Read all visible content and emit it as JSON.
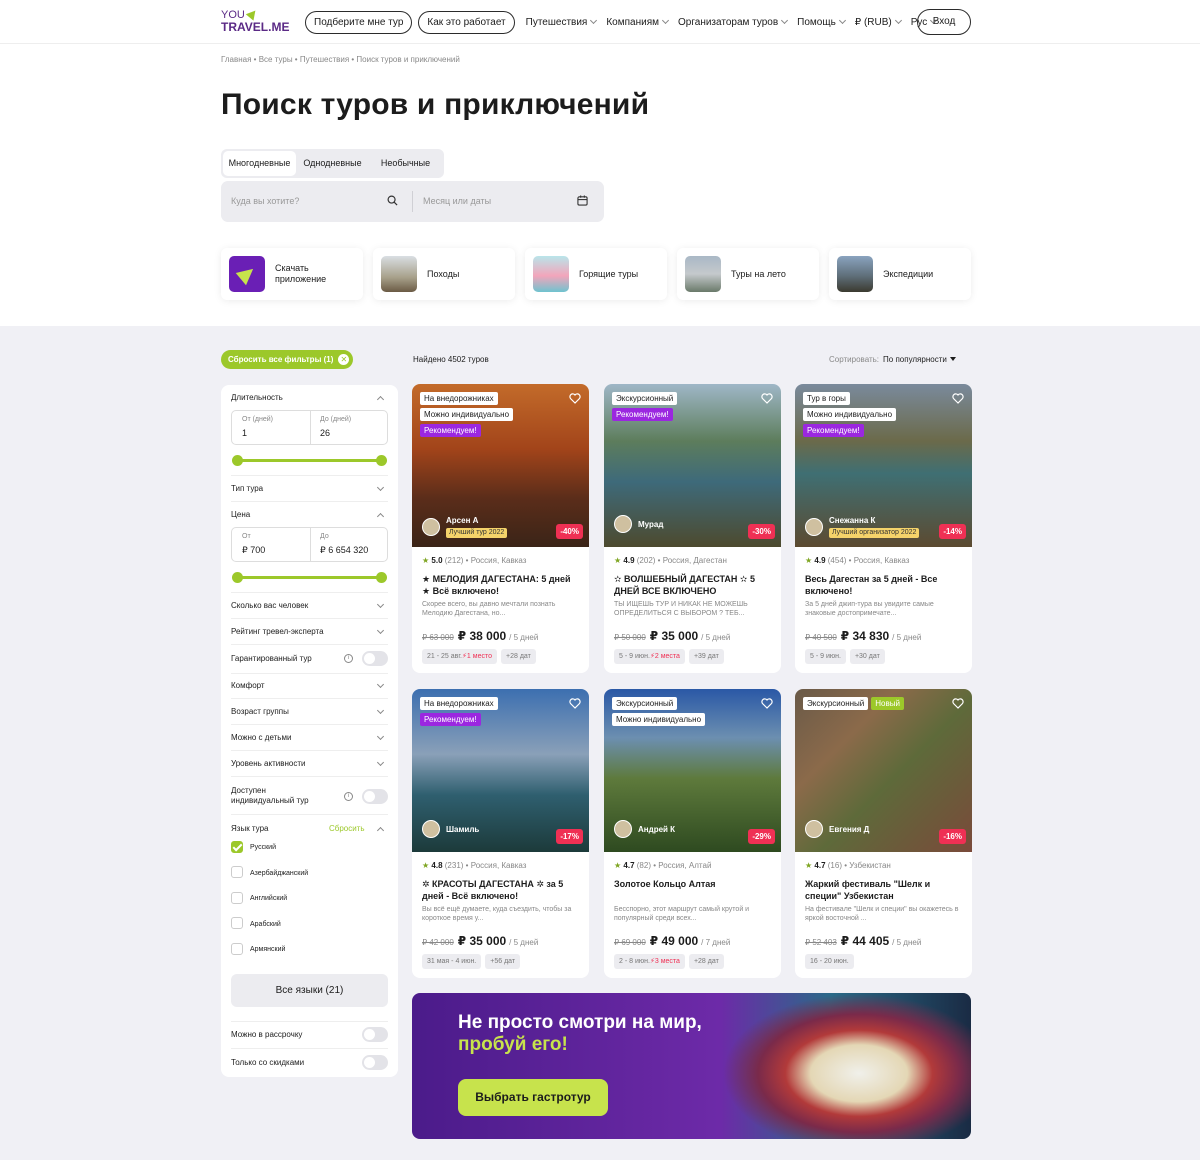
{
  "header": {
    "logo_line1": "YOU",
    "logo_line2": "TRAVEL.ME",
    "pill1": "Подберите мне тур",
    "pill2": "Как это работает",
    "nav": [
      "Путешествия",
      "Компаниям",
      "Организаторам туров",
      "Помощь",
      "₽ (RUB)",
      "Рус"
    ],
    "login": "Вход"
  },
  "breadcrumb": "Главная  •  Все туры  •  Путешествия  •  Поиск туров и приключений",
  "page_title": "Поиск туров и приключений",
  "tabs": [
    "Многодневные",
    "Однодневные",
    "Необычные"
  ],
  "search": {
    "where_placeholder": "Куда вы хотите?",
    "date_placeholder": "Месяц или даты"
  },
  "quick_links": [
    "Скачать приложение",
    "Походы",
    "Горящие туры",
    "Туры на лето",
    "Экспедиции"
  ],
  "reset_filters": "Сбросить все фильтры (1)",
  "found": "Найдено 4502 туров",
  "sort": {
    "label": "Сортировать:",
    "value": "По популярности"
  },
  "sidebar": {
    "duration": "Длительность",
    "dur_from_l": "От (дней)",
    "dur_from_v": "1",
    "dur_to_l": "До (дней)",
    "dur_to_v": "26",
    "tour_type": "Тип тура",
    "price": "Цена",
    "price_from_l": "От",
    "price_from_v": "₽ 700",
    "price_to_l": "До",
    "price_to_v": "₽ 6 654 320",
    "people": "Сколько вас человек",
    "rating": "Рейтинг тревел-эксперта",
    "guaranteed": "Гарантированный тур",
    "comfort": "Комфорт",
    "age": "Возраст группы",
    "kids": "Можно с детьми",
    "activity": "Уровень активности",
    "individual": "Доступен индивидуальный тур",
    "language": "Язык тура",
    "lang_reset": "Сбросить",
    "langs": [
      "Русский",
      "Азербайджанский",
      "Английский",
      "Арабский",
      "Армянский"
    ],
    "all_langs": "Все языки (21)",
    "installment": "Можно в рассрочку",
    "discounts": "Только со скидками"
  },
  "cards": [
    {
      "badges": [
        "На внедорожниках",
        "Можно индивидуально",
        "Рекомендуем!"
      ],
      "guide": "Арсен А",
      "award": "Лучший тур 2022",
      "discount": "-40%",
      "rating": "5.0",
      "reviews": "(212)",
      "place": "Россия, Кавказ",
      "title": "★ МЕЛОДИЯ ДАГЕСТАНА: 5 дней ★ Всё включено!",
      "desc": "Скорее всего, вы давно мечтали познать Мелодию Дагестана, но...",
      "old": "₽ 63 000",
      "price": "₽ 38 000",
      "days": "/ 5 дней",
      "date": "21 - 25 авг.",
      "seats": "1 место",
      "more": "+28 дат",
      "img": "linear-gradient(180deg,#c36b2a 0%,#a2441a 40%,#5b2d1a 70%,#3a2417 100%)"
    },
    {
      "badges": [
        "Экскурсионный",
        "Рекомендуем!"
      ],
      "guide": "Мурад",
      "award": "",
      "discount": "-30%",
      "rating": "4.9",
      "reviews": "(202)",
      "place": "Россия, Дагестан",
      "title": "✫ ВОЛШЕБНЫЙ ДАГЕСТАН ✫ 5 ДНЕЙ ВСЕ ВКЛЮЧЕНО",
      "desc": "ТЫ ИЩЕШЬ ТУР И НИКАК НЕ МОЖЕШЬ ОПРЕДЕЛИТЬСЯ С ВЫБОРОМ ? ТЕБ...",
      "old": "₽ 50 000",
      "price": "₽ 35 000",
      "days": "/ 5 дней",
      "date": "5 - 9 июн.",
      "seats": "2 места",
      "more": "+39 дат",
      "img": "linear-gradient(180deg,#9fb7c7 0%,#5d7d5c 35%,#3e6a7a 60%,#4d4a2e 100%)"
    },
    {
      "badges": [
        "Тур в горы",
        "Можно индивидуально",
        "Рекомендуем!"
      ],
      "guide": "Снежанна К",
      "award": "Лучший организатор 2022",
      "discount": "-14%",
      "rating": "4.9",
      "reviews": "(454)",
      "place": "Россия, Кавказ",
      "title": "Весь Дагестан за 5 дней - Все включено!",
      "desc": "За 5 дней джип-тура вы увидите самые знаковые достопримечате...",
      "old": "₽ 40 500",
      "price": "₽ 34 830",
      "days": "/ 5 дней",
      "date": "5 - 9 июн.",
      "seats": "",
      "more": "+30 дат",
      "img": "linear-gradient(180deg,#7a8a9c 0%,#6b6a4a 35%,#3f6f73 55%,#5c4a30 100%)"
    },
    {
      "badges": [
        "На внедорожниках",
        "Рекомендуем!"
      ],
      "guide": "Шамиль",
      "award": "",
      "discount": "-17%",
      "rating": "4.8",
      "reviews": "(231)",
      "place": "Россия, Кавказ",
      "title": "✲ КРАСОТЫ ДАГЕСТАНА ✲ за 5 дней - Всё включено!",
      "desc": "Вы всё ещё думаете, куда съездить, чтобы за короткое время у...",
      "old": "₽ 42 000",
      "price": "₽ 35 000",
      "days": "/ 5 дней",
      "date": "31 мая - 4 июн.",
      "seats": "",
      "more": "+56 дат",
      "img": "linear-gradient(180deg,#3c6fb0 0%,#8aa0b8 40%,#2f5f6f 65%,#1c3a3a 100%)"
    },
    {
      "badges": [
        "Экскурсионный",
        "Можно индивидуально"
      ],
      "guide": "Андрей К",
      "award": "",
      "discount": "-29%",
      "rating": "4.7",
      "reviews": "(82)",
      "place": "Россия, Алтай",
      "title": "Золотое Кольцо Алтая",
      "desc": "Бесспорно, этот маршрут самый крутой и популярный среди всех...",
      "old": "₽ 69 000",
      "price": "₽ 49 000",
      "days": "/ 7 дней",
      "date": "2 - 8 июн.",
      "seats": "3 места",
      "more": "+28 дат",
      "img": "linear-gradient(180deg,#2a58a6 0%,#6c8fb0 30%,#5e7a3c 55%,#2e4a20 100%)"
    },
    {
      "badges": [
        "Экскурсионный",
        "Новый"
      ],
      "guide": "Евгения Д",
      "award": "",
      "discount": "-16%",
      "rating": "4.7",
      "reviews": "(16)",
      "place": "Узбекистан",
      "title": "Жаркий фестиваль \"Шелк и специи\" Узбекистан",
      "desc": "На фестивале \"Шелк и специи\" вы окажетесь в яркой восточной ...",
      "old": "₽ 52 403",
      "price": "₽ 44 405",
      "days": "/ 5 дней",
      "date": "16 - 20 июн.",
      "seats": "",
      "more": "",
      "img": "linear-gradient(135deg,#6a5a48 0%,#8b6a4a 30%,#5e6a3a 55%,#7a4a3a 100%)"
    }
  ],
  "banner": {
    "line1": "Не просто смотри на мир,",
    "line2": "пробуй его!",
    "button": "Выбрать гастротур"
  }
}
